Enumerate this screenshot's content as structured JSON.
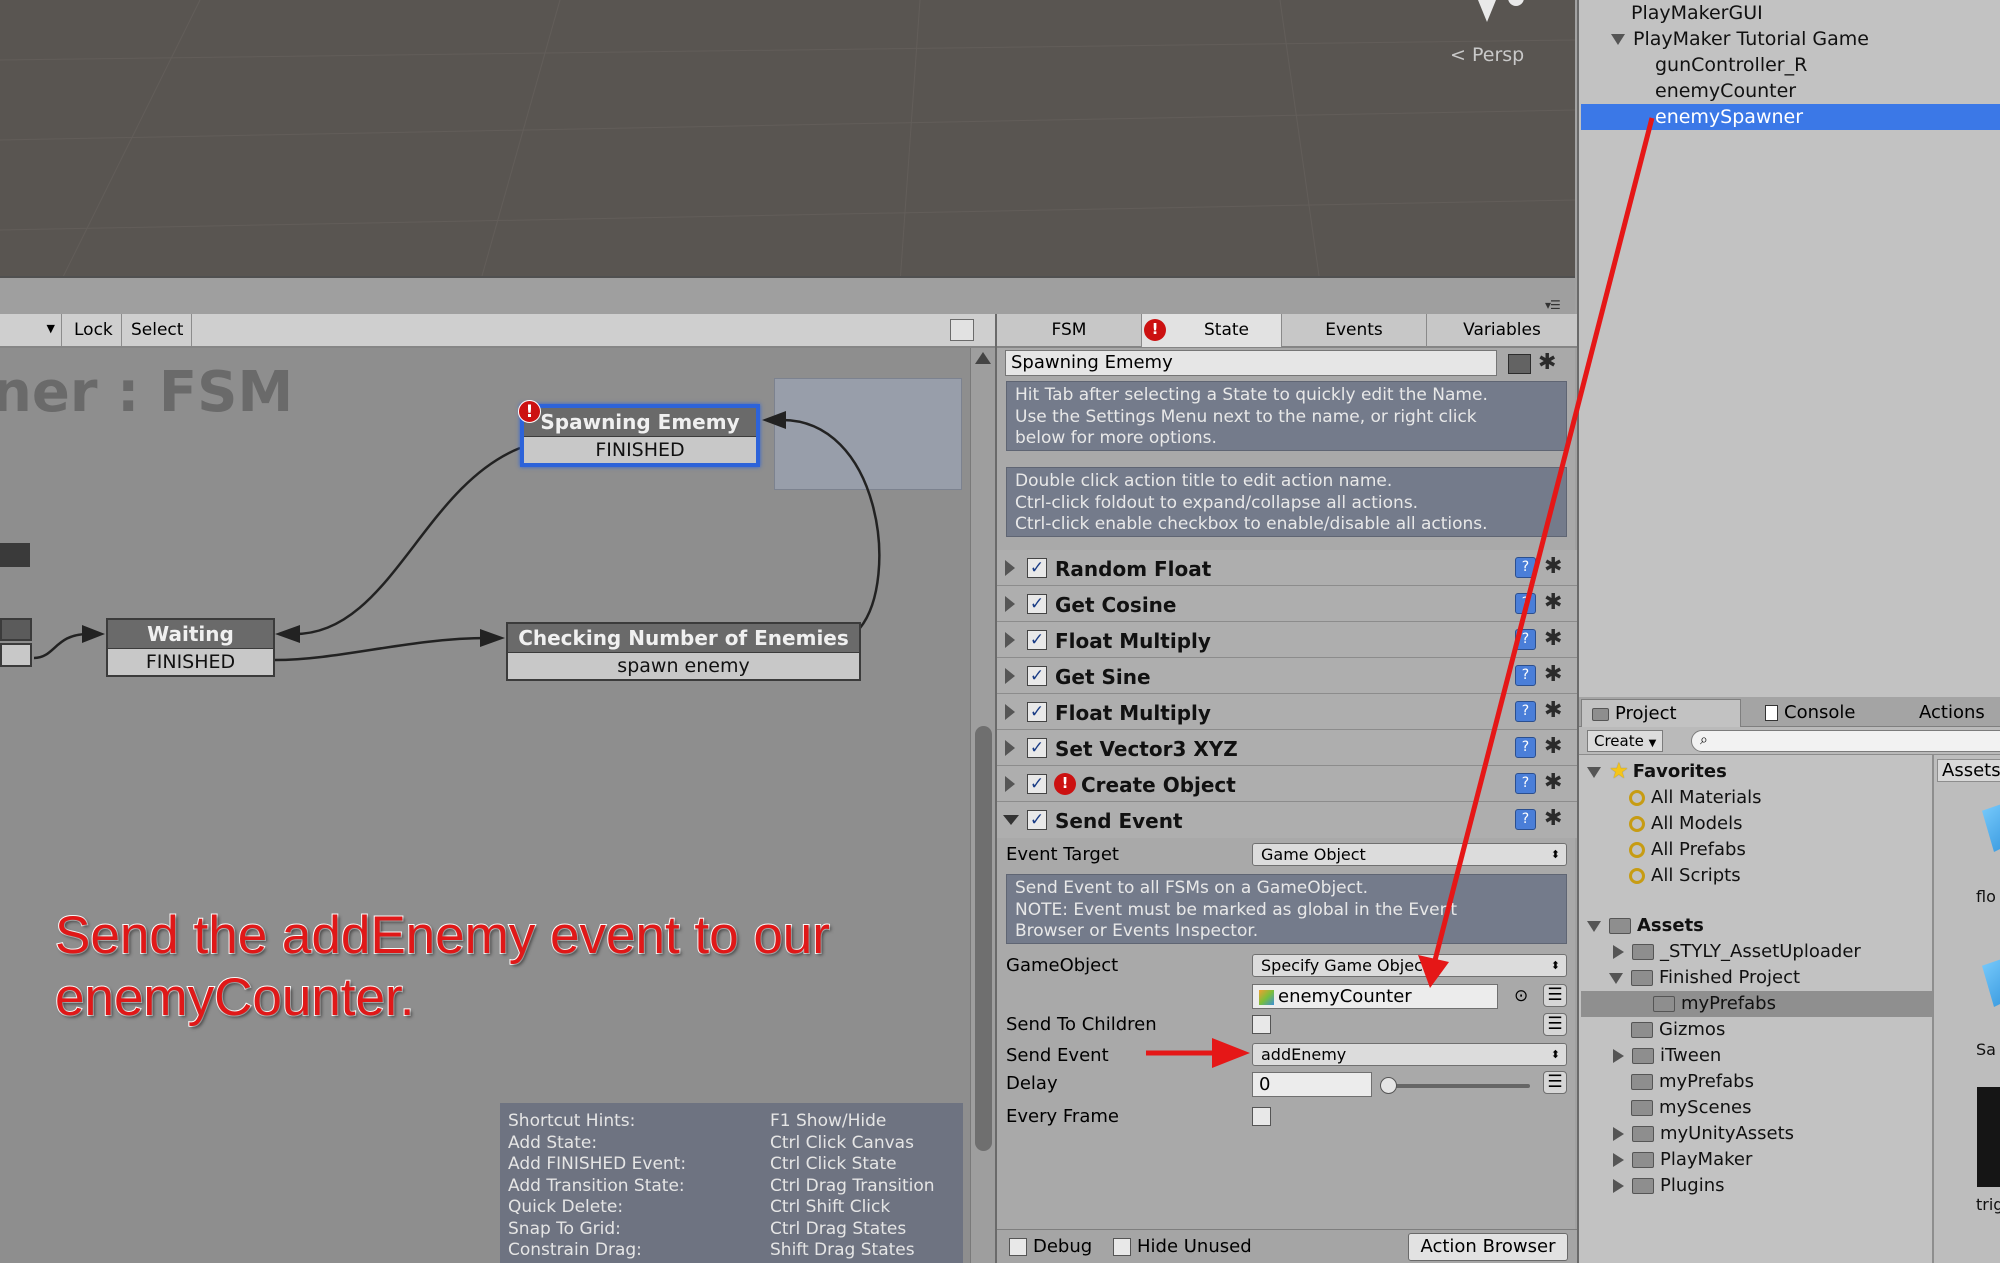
{
  "scene": {
    "persp_label": "Persp"
  },
  "fsm_toolbar": {
    "lock": "Lock",
    "select": "Select"
  },
  "fsm_canvas": {
    "title": "ner : FSM",
    "states": {
      "spawning": {
        "title": "Spawning Ememy",
        "event": "FINISHED"
      },
      "waiting": {
        "title": "Waiting",
        "event": "FINISHED"
      },
      "checking": {
        "title": "Checking Number of Enemies",
        "event": "spawn enemy"
      }
    },
    "error_mark": "!",
    "hints": [
      {
        "k": "Shortcut Hints:",
        "v": "F1 Show/Hide"
      },
      {
        "k": "Add State:",
        "v": "Ctrl Click Canvas"
      },
      {
        "k": "Add FINISHED Event:",
        "v": "Ctrl Click State"
      },
      {
        "k": "Add Transition State:",
        "v": "Ctrl Drag Transition"
      },
      {
        "k": "Quick Delete:",
        "v": "Ctrl Shift Click"
      },
      {
        "k": "Snap To Grid:",
        "v": "Ctrl Drag States"
      },
      {
        "k": "Constrain Drag:",
        "v": "Shift Drag States"
      }
    ]
  },
  "annotation": {
    "line1": "Send the addEnemy event to our",
    "line2": "enemyCounter."
  },
  "inspector": {
    "tabs": {
      "fsm": "FSM",
      "state": "State",
      "events": "Events",
      "variables": "Variables"
    },
    "state_name": "Spawning Ememy",
    "info1": [
      "Hit Tab after selecting a State to quickly edit the Name.",
      "Use the Settings Menu next to the name, or right click",
      "below for more options."
    ],
    "info2": [
      "Double click action title to edit action name.",
      "Ctrl-click foldout to expand/collapse all actions.",
      "Ctrl-click enable checkbox to enable/disable all actions."
    ],
    "actions": [
      "Random Float",
      "Get Cosine",
      "Float Multiply",
      "Get Sine",
      "Float Multiply",
      "Set Vector3 XYZ",
      "Create Object",
      "Send Event"
    ],
    "send_event": {
      "event_target_label": "Event Target",
      "event_target_value": "Game Object",
      "info": [
        "Send Event to all FSMs on a GameObject.",
        "NOTE: Event must be marked as global in the Event",
        "Browser or Events Inspector."
      ],
      "gameobject_label": "GameObject",
      "gameobject_value": "Specify Game Object",
      "object_field": "enemyCounter",
      "send_children_label": "Send To Children",
      "send_event_label": "Send Event",
      "send_event_value": "addEnemy",
      "delay_label": "Delay",
      "delay_value": "0",
      "every_frame_label": "Every Frame"
    },
    "bottom": {
      "debug": "Debug",
      "hide_unused": "Hide Unused",
      "action_browser": "Action Browser"
    },
    "check_glyph": "✓",
    "help_glyph": "?",
    "gear_glyph": "✱",
    "eq_glyph": "☰"
  },
  "hierarchy": {
    "items": [
      "PlayMakerGUI",
      "PlayMaker Tutorial Game",
      "gunController_R",
      "enemyCounter",
      "enemySpawner"
    ]
  },
  "project": {
    "tabs": {
      "project": "Project",
      "console": "Console",
      "actions": "Actions"
    },
    "create": "Create",
    "favorites_label": "Favorites",
    "favorites": [
      "All Materials",
      "All Models",
      "All Prefabs",
      "All Scripts"
    ],
    "assets_label": "Assets",
    "assets": [
      "_STYLY_AssetUploader",
      "Finished Project",
      "myPrefabs",
      "Gizmos",
      "iTween",
      "myPrefabs",
      "myScenes",
      "myUnityAssets",
      "PlayMaker",
      "Plugins"
    ],
    "assets_header": "Assets",
    "asset_labels": [
      "flo",
      "Sa",
      "trig"
    ]
  },
  "colors": {
    "selection": "#3b78e7",
    "annotation_red": "#e01818",
    "state_selected_border": "#2d63d9"
  }
}
